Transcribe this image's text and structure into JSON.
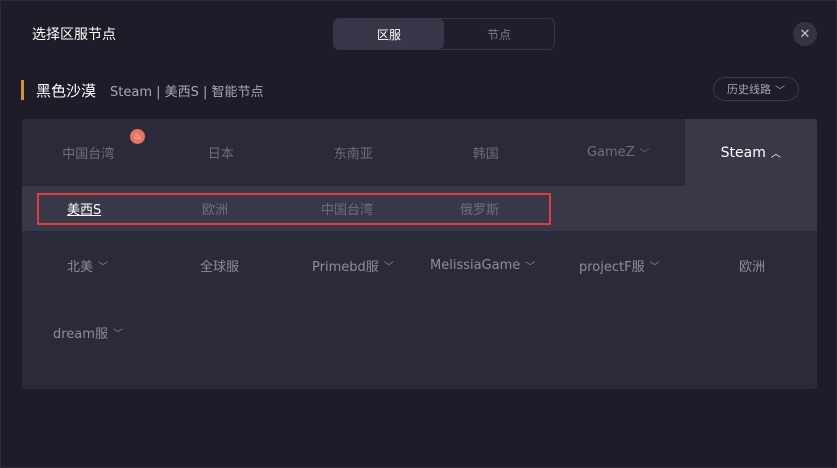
{
  "dialog": {
    "title": "选择区服节点",
    "tabs": [
      "区服",
      "节点"
    ]
  },
  "game": {
    "name": "黑色沙漠",
    "path": "Steam | 美西S | 智能节点",
    "history_label": "历史线路"
  },
  "server_tabs": [
    {
      "label": "中国台湾",
      "hot": true
    },
    {
      "label": "日本"
    },
    {
      "label": "东南亚"
    },
    {
      "label": "韩国"
    },
    {
      "label": "GameZ",
      "chevron": "down"
    },
    {
      "label": "Steam",
      "chevron": "up",
      "active": true
    }
  ],
  "sub_regions": [
    {
      "label": "美西S",
      "active": true
    },
    {
      "label": "欧洲"
    },
    {
      "label": "中国台湾"
    },
    {
      "label": "俄罗斯"
    }
  ],
  "regions": [
    {
      "label": "北美",
      "chevron": true
    },
    {
      "label": "全球服"
    },
    {
      "label": "Primebd服",
      "chevron": true
    },
    {
      "label": "MelissiaGame",
      "chevron": true
    },
    {
      "label": "projectF服",
      "chevron": true
    },
    {
      "label": "欧洲"
    },
    {
      "label": "dream服",
      "chevron": true
    }
  ],
  "colors": {
    "accent": "#c89a2f",
    "selection_outline": "#e03c40",
    "panel_bg": "#2b2a3a",
    "active_bg": "#383849"
  },
  "icons": {
    "close": "close-icon",
    "hot": "fire-icon",
    "chevron": "chevron-icon"
  }
}
